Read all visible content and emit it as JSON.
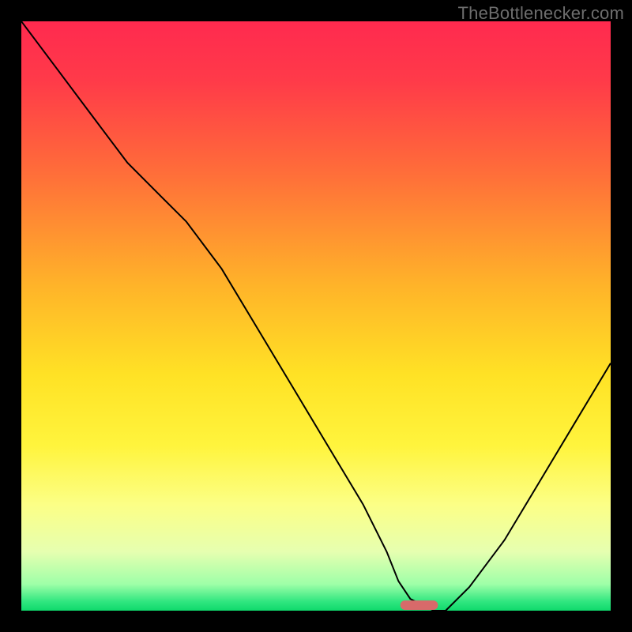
{
  "watermark": {
    "text": "TheBottlenecker.com"
  },
  "chart_data": {
    "type": "line",
    "title": "",
    "xlabel": "",
    "ylabel": "",
    "xlim": [
      0,
      100
    ],
    "ylim": [
      0,
      100
    ],
    "background": {
      "type": "vertical-gradient",
      "stops": [
        {
          "offset": 0.0,
          "color": "#ff2a4f"
        },
        {
          "offset": 0.1,
          "color": "#ff3a49"
        },
        {
          "offset": 0.25,
          "color": "#ff6b3a"
        },
        {
          "offset": 0.45,
          "color": "#ffb429"
        },
        {
          "offset": 0.6,
          "color": "#ffe225"
        },
        {
          "offset": 0.72,
          "color": "#fff43d"
        },
        {
          "offset": 0.82,
          "color": "#fcff86"
        },
        {
          "offset": 0.9,
          "color": "#e6ffb0"
        },
        {
          "offset": 0.955,
          "color": "#9effa8"
        },
        {
          "offset": 0.985,
          "color": "#2fe67f"
        },
        {
          "offset": 1.0,
          "color": "#0fd96c"
        }
      ]
    },
    "series": [
      {
        "name": "bottleneck-curve",
        "color": "#000000",
        "width": 2,
        "x": [
          0,
          6,
          12,
          18,
          24,
          28,
          34,
          40,
          46,
          52,
          58,
          62,
          64,
          66,
          70,
          72,
          76,
          82,
          88,
          94,
          100
        ],
        "y": [
          100,
          92,
          84,
          76,
          70,
          66,
          58,
          48,
          38,
          28,
          18,
          10,
          5,
          2,
          0,
          0,
          4,
          12,
          22,
          32,
          42
        ]
      }
    ],
    "marker": {
      "shape": "rounded-bar",
      "color": "#d86a6a",
      "x_center": 67.5,
      "x_halfwidth": 3.2,
      "y": 0,
      "height_pct": 1.6
    }
  }
}
